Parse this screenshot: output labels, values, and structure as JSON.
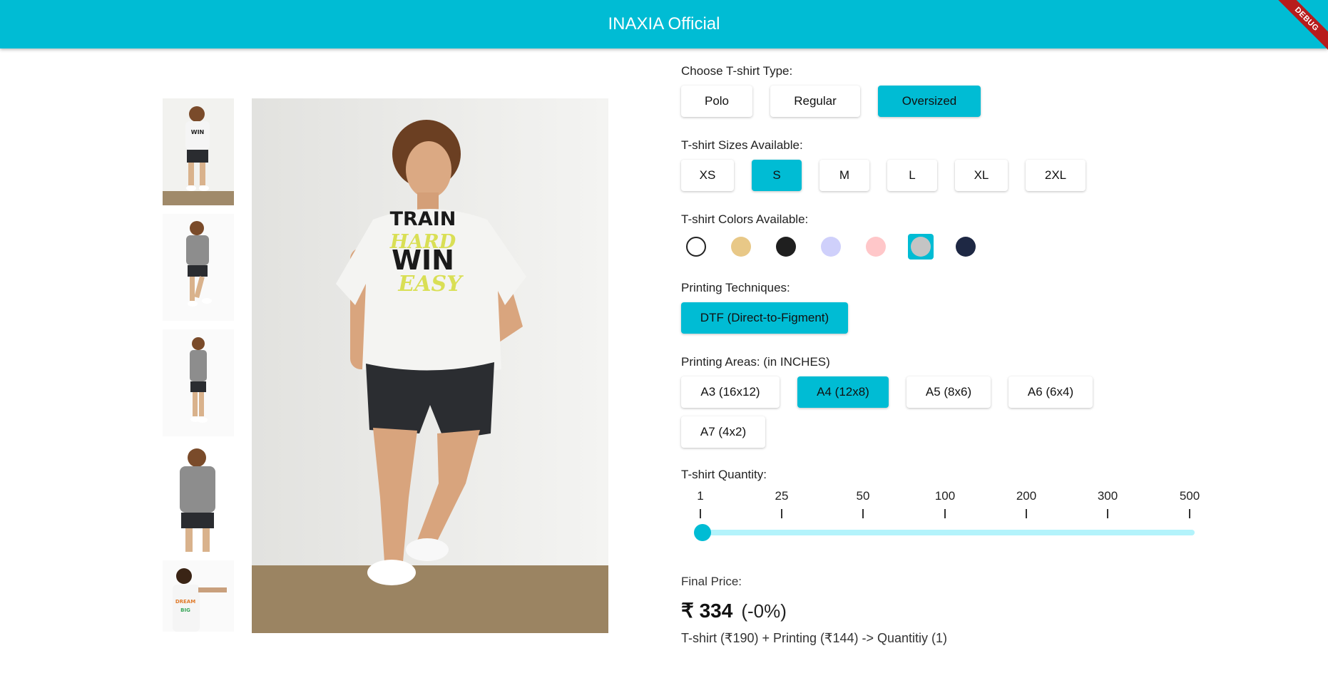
{
  "app": {
    "title": "INAXIA Official",
    "debug_banner": "DEBUG"
  },
  "gallery": {
    "thumbnails": [
      {
        "label": "front view, white oversized tee"
      },
      {
        "label": "walking, grey tee"
      },
      {
        "label": "side view, grey tee"
      },
      {
        "label": "back view, grey tee"
      },
      {
        "label": "model stretching, white tee"
      }
    ],
    "main_image": "model in white oversized tee"
  },
  "type": {
    "label": "Choose T-shirt Type:",
    "options": [
      "Polo",
      "Regular",
      "Oversized"
    ],
    "selected": "Oversized"
  },
  "sizes": {
    "label": "T-shirt Sizes Available:",
    "options": [
      "XS",
      "S",
      "M",
      "L",
      "XL",
      "2XL"
    ],
    "selected": "S"
  },
  "colors": {
    "label": "T-shirt Colors Available:",
    "options": [
      "#ffffff",
      "#e8c887",
      "#1f1f1f",
      "#cfd0fb",
      "#ffc7c9",
      "#c4c4c4",
      "#1e2844"
    ],
    "selected_index": 5
  },
  "printing": {
    "label": "Printing Techniques:",
    "options": [
      "DTF (Direct-to-Figment)"
    ],
    "selected": "DTF (Direct-to-Figment)"
  },
  "areas": {
    "label": "Printing Areas: (in INCHES)",
    "options": [
      "A3 (16x12)",
      "A4 (12x8)",
      "A5 (8x6)",
      "A6 (6x4)",
      "A7 (4x2)"
    ],
    "selected": "A4 (12x8)"
  },
  "quantity": {
    "label": "T-shirt Quantity:",
    "ticks": [
      "1",
      "25",
      "50",
      "100",
      "200",
      "300",
      "500"
    ],
    "value_index": 0
  },
  "price": {
    "label": "Final Price:",
    "amount": "₹ 334",
    "discount": "(-0%)",
    "breakdown": "T-shirt (₹190) + Printing (₹144)  ->  Quantitiy (1)"
  },
  "theme": {
    "accent": "#00bcd4",
    "track": "#b3f3fb"
  }
}
